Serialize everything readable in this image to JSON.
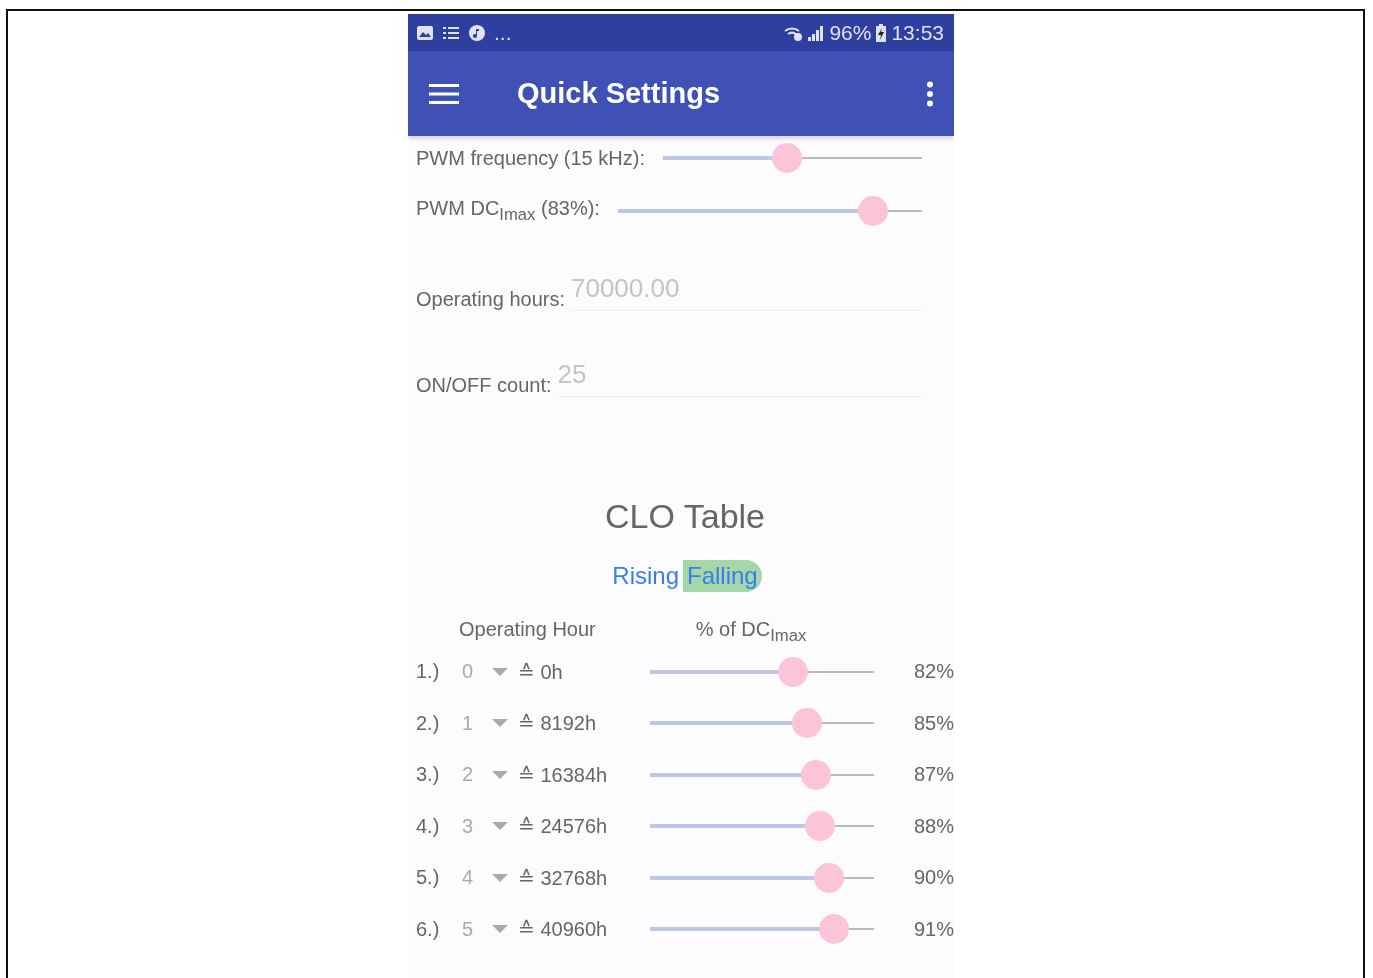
{
  "status_bar": {
    "overflow": "...",
    "battery": "96%",
    "time": "13:53"
  },
  "app_bar": {
    "title": "Quick Settings"
  },
  "settings": [
    {
      "label": "PWM frequency (15 kHz):",
      "level": 0.48
    },
    {
      "label": "PWM DC$_{Imax}$ (83%):",
      "level": 0.84
    }
  ],
  "fields": [
    {
      "label": "Operating hours:",
      "value": "70000.00"
    },
    {
      "label": "ON/OFF count:",
      "value": "25"
    }
  ],
  "clo_table": {
    "title": "CLO Table",
    "toggle": [
      {
        "label": "Rising",
        "selected": false
      },
      {
        "label": "Falling",
        "selected": true
      }
    ],
    "columns": [
      "Operating Hour",
      "% of DC$_{Imax}$"
    ],
    "rows": [
      {
        "index": "1.)",
        "step": "0",
        "hours": "≙ 0h",
        "level": 0.64,
        "percent": "82%"
      },
      {
        "index": "2.)",
        "step": "1",
        "hours": "≙ 8192h",
        "level": 0.7,
        "percent": "85%"
      },
      {
        "index": "3.)",
        "step": "2",
        "hours": "≙ 16384h",
        "level": 0.74,
        "percent": "87%"
      },
      {
        "index": "4.)",
        "step": "3",
        "hours": "≙ 24576h",
        "level": 0.76,
        "percent": "88%"
      },
      {
        "index": "5.)",
        "step": "4",
        "hours": "≙ 32768h",
        "level": 0.8,
        "percent": "90%"
      },
      {
        "index": "6.)",
        "step": "5",
        "hours": "≙ 40960h",
        "level": 0.82,
        "percent": "91%"
      }
    ]
  }
}
